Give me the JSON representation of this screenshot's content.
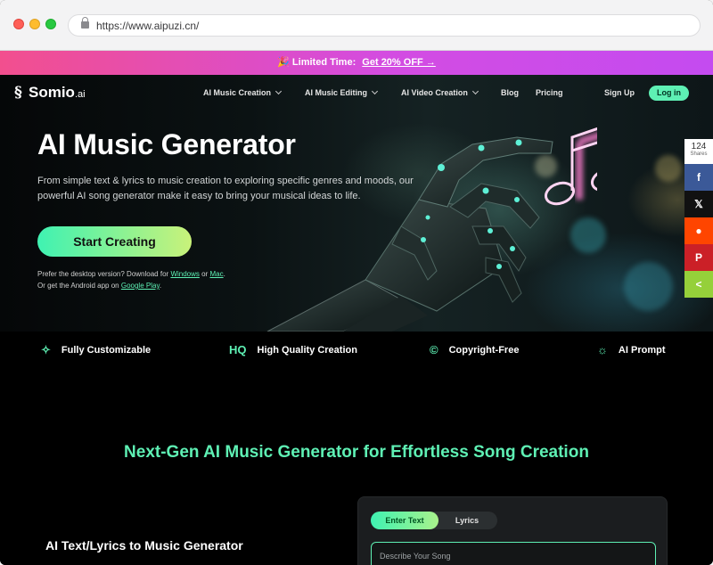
{
  "browser": {
    "url": "https://www.aipuzi.cn/"
  },
  "promo": {
    "prefix": "🎉 Limited Time:",
    "link": "Get 20% OFF →"
  },
  "nav": {
    "logo_main": "Somio",
    "logo_suffix": ".ai",
    "items": [
      "AI Music Creation",
      "AI Music Editing",
      "AI Video Creation",
      "Blog",
      "Pricing"
    ],
    "signup": "Sign Up",
    "login": "Log in"
  },
  "hero": {
    "title": "AI Music Generator",
    "description": "From simple text & lyrics to music creation to exploring specific genres and moods, our powerful AI song generator make it easy to bring your musical ideas to life.",
    "cta": "Start Creating",
    "download_prefix": "Prefer the desktop version? Download for",
    "windows": "Windows",
    "or": "or",
    "mac": "Mac",
    "android_prefix": "Or get the Android app on",
    "google_play": "Google Play"
  },
  "features": [
    {
      "icon": "magic-wand-icon",
      "glyph": "✧",
      "label": "Fully Customizable"
    },
    {
      "icon": "hq-icon",
      "glyph": "HQ",
      "label": "High Quality Creation"
    },
    {
      "icon": "copyright-icon",
      "glyph": "©",
      "label": "Copyright-Free"
    },
    {
      "icon": "lightbulb-icon",
      "glyph": "☼",
      "label": "AI Prompt"
    }
  ],
  "section": {
    "title": "Next-Gen AI Music Generator for Effortless Song Creation",
    "subtitle": "AI Text/Lyrics to Music Generator",
    "tabs": [
      "Enter Text",
      "Lyrics"
    ],
    "input_placeholder": "Describe Your Song"
  },
  "share": {
    "count": "124",
    "count_label": "Shares",
    "buttons": [
      {
        "name": "facebook",
        "glyph": "f",
        "color": "#3b5998"
      },
      {
        "name": "x",
        "glyph": "𝕏",
        "color": "#111111"
      },
      {
        "name": "reddit",
        "glyph": "●",
        "color": "#ff4500"
      },
      {
        "name": "pinterest",
        "glyph": "P",
        "color": "#cb2027"
      },
      {
        "name": "sharethis",
        "glyph": "<",
        "color": "#95d03a"
      }
    ]
  },
  "colors": {
    "accent": "#5ef0b4",
    "promo_start": "#f24f8e",
    "promo_end": "#c44bf0",
    "note_glow": "#ff8fd6"
  }
}
